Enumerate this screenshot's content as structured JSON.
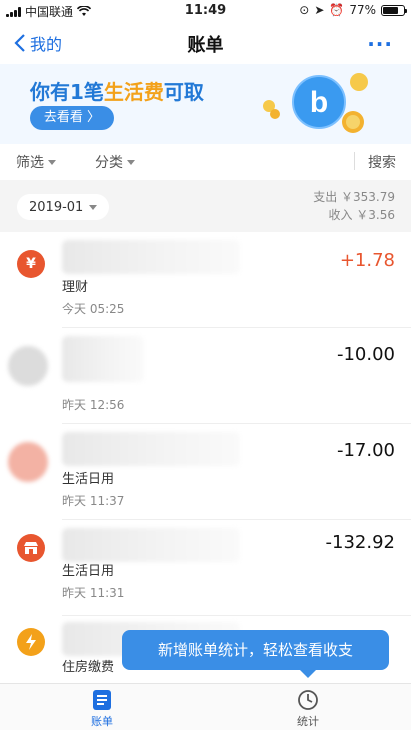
{
  "status_bar": {
    "carrier": "中国联通",
    "time": "11:49",
    "battery": "77%"
  },
  "nav": {
    "back_label": "我的",
    "title": "账单",
    "more_label": "···"
  },
  "banner": {
    "text_prefix": "你有1笔",
    "text_highlight": "生活费",
    "text_suffix": "可取",
    "button_label": "去看看 〉"
  },
  "filters": {
    "filter_label": "筛选",
    "category_label": "分类",
    "search_label": "搜索"
  },
  "month": {
    "selected": "2019-01",
    "expense": "支出 ￥353.79",
    "income": "收入 ￥3.56"
  },
  "transactions": [
    {
      "icon": "wealth-icon",
      "icon_color": "#e8562f",
      "category": "理财",
      "time": "今天  05:25",
      "amount": "+1.78",
      "type": "income"
    },
    {
      "icon": "avatar-icon",
      "icon_color": "#dcdcdc",
      "category": "",
      "time": "昨天  12:56",
      "amount": "-10.00",
      "type": "expense"
    },
    {
      "icon": "shop-icon",
      "icon_color": "#f3b2a4",
      "category": "生活日用",
      "time": "昨天  11:37",
      "amount": "-17.00",
      "type": "expense"
    },
    {
      "icon": "store-icon",
      "icon_color": "#e8562f",
      "category": "生活日用",
      "time": "昨天  11:31",
      "amount": "-132.92",
      "type": "expense"
    },
    {
      "icon": "bolt-icon",
      "icon_color": "#f3a11a",
      "category": "住房缴费",
      "time": "",
      "amount": "",
      "type": "expense"
    }
  ],
  "toast": {
    "text": "新增账单统计，轻松查看收支"
  },
  "tabs": [
    {
      "label": "账单",
      "active": true
    },
    {
      "label": "统计",
      "active": false
    }
  ],
  "colors": {
    "accent": "#1e6fe0",
    "income": "#e8562f",
    "banner_highlight": "#f3a11a"
  }
}
